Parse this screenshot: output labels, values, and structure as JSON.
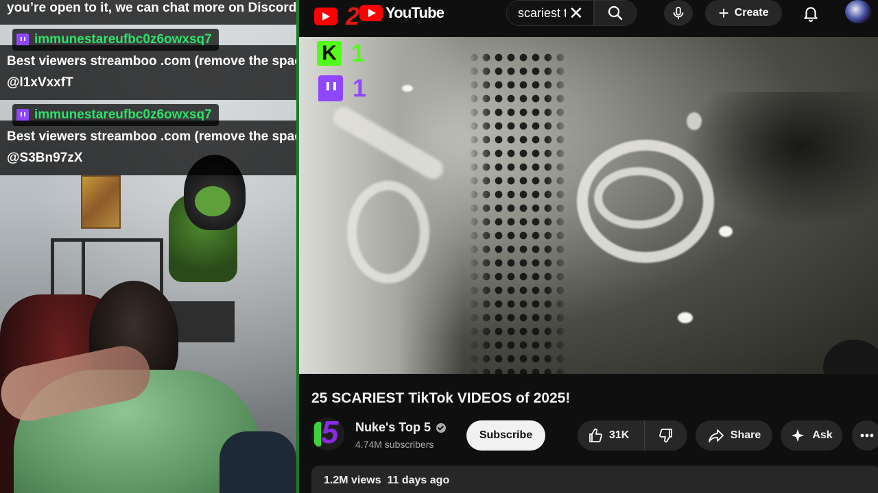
{
  "chat": {
    "top_message": "you’re open to it, we can chat more on Discord 👍",
    "messages": [
      {
        "username": "immunestareufbc0z6owxsq7",
        "line1": "Best viewers streamboo .com (remove the space)",
        "line2": "@l1xVxxfT"
      },
      {
        "username": "immunestareufbc0z6owxsq7",
        "line1": "Best viewers streamboo .com (remove the space)",
        "line2": "@S3Bn97zX"
      }
    ]
  },
  "overlay": {
    "youtube_count": "2",
    "kick_count": "1",
    "kick_letter": "K",
    "twitch_count": "1"
  },
  "youtube": {
    "logo_text": "YouTube",
    "search": {
      "value": "scariest t"
    },
    "create_label": "Create",
    "video": {
      "title": "25 SCARIEST TikTok VIDEOS of 2025!",
      "channel_name": "Nuke's Top 5",
      "channel_avatar_text": "5",
      "subscribers": "4.74M subscribers",
      "subscribe_label": "Subscribe",
      "likes": "31K",
      "share_label": "Share",
      "ask_label": "Ask",
      "views": "1.2M views",
      "uploaded": "11 days ago"
    }
  },
  "colors": {
    "youtube_red": "#ff0000",
    "kick_green": "#53fc18",
    "twitch_purple": "#9147ff",
    "chat_username_green": "#2ee26a"
  },
  "icons": [
    "youtube-play-icon",
    "close-icon",
    "search-icon",
    "mic-icon",
    "plus-icon",
    "bell-icon",
    "verified-icon",
    "thumb-up-icon",
    "thumb-down-icon",
    "share-arrow-icon",
    "sparkle-icon",
    "more-dots-icon",
    "twitch-icon",
    "kick-icon"
  ]
}
